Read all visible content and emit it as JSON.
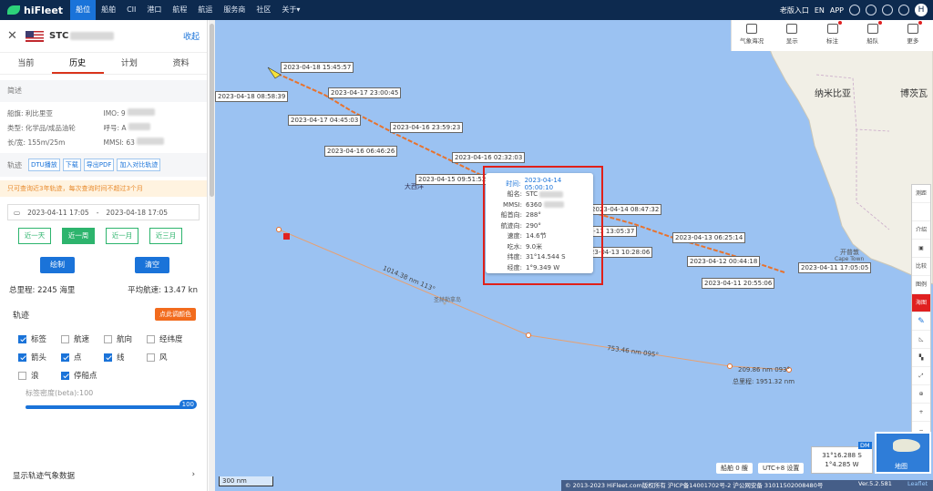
{
  "brand": {
    "name": "hiFleet"
  },
  "nav": [
    "船位",
    "船舶",
    "CII",
    "港口",
    "航程",
    "航运",
    "服务商",
    "社区",
    "关于▾"
  ],
  "topright": {
    "entry": "老版入口",
    "lang": "EN",
    "app": "APP",
    "avatar": "H"
  },
  "vessel": {
    "name_prefix": "STC",
    "collapse": "收起"
  },
  "tabs": [
    "当前",
    "历史",
    "计划",
    "资料"
  ],
  "overview": {
    "title": "简述",
    "rows": [
      [
        "船旗: 利比里亚",
        "IMO: 9"
      ],
      [
        "类型: 化学品/成品油轮",
        "呼号: A"
      ],
      [
        "长/宽: 155m/25m",
        "MMSI: 63"
      ]
    ]
  },
  "track_header": {
    "label": "轨迹",
    "buttons": [
      "DTU播放",
      "下载",
      "导出PDF",
      "加入对比轨迹"
    ]
  },
  "notice": "只可查询近3年轨迹，每次查询时间不超过3个月",
  "date_range": {
    "start": "2023-04-11 17:05",
    "sep": "-",
    "end": "2023-04-18 17:05"
  },
  "quick": [
    "近一天",
    "近一周",
    "近一月",
    "近三月"
  ],
  "actions": {
    "draw": "绘制",
    "clear": "清空"
  },
  "stats": {
    "total": "总里程: 2245 海里",
    "avg": "平均航速: 13.47 kn"
  },
  "track": {
    "title": "轨迹",
    "color_btn": "点此调颜色"
  },
  "options": [
    {
      "label": "标签",
      "checked": true
    },
    {
      "label": "航速",
      "checked": false
    },
    {
      "label": "航向",
      "checked": false
    },
    {
      "label": "经纬度",
      "checked": false
    },
    {
      "label": "箭头",
      "checked": true
    },
    {
      "label": "点",
      "checked": true
    },
    {
      "label": "线",
      "checked": true
    },
    {
      "label": "风",
      "checked": false
    },
    {
      "label": "浪",
      "checked": false
    },
    {
      "label": "停船点",
      "checked": true
    }
  ],
  "density": {
    "label": "标签密度(beta):100",
    "value": "100"
  },
  "weather_toggle": "显示轨迹气象数据",
  "map": {
    "track_labels": [
      "2023-04-18 15:45:57",
      "2023-04-18 08:58:39",
      "2023-04-17 23:00:45",
      "2023-04-17 04:45:03",
      "2023-04-16 23:59:23",
      "2023-04-16 06:46:26",
      "2023-04-16 02:32:03",
      "2023-04-15 09:51:52",
      "2023-04-14 08:47:32",
      "2023-04-13 13:05:37",
      "2023-04-13 10:28:06",
      "2023-04-13 06:25:14",
      "2023-04-12 00:44:18",
      "2023-04-11 17:05:05",
      "2023-04-11 20:55:06"
    ],
    "place_labels": {
      "namibia": "纳米比亚",
      "botswana": "博茨瓦",
      "ocean": "大西洋",
      "capetown_cn": "开普敦",
      "capetown_en": "Cape Town",
      "island": "圣赫勒拿岛"
    },
    "route_labels": {
      "seg1": "1014.38 nm 113°",
      "seg2": "753.46 nm 095°",
      "seg3": "209.86 nm 093°",
      "total": "总里程: 1951.32 nm"
    },
    "popup": {
      "rows": [
        [
          "时间:",
          "2023-04-14 05:00:10"
        ],
        [
          "船名:",
          "STC"
        ],
        [
          "MMSI:",
          "6360"
        ],
        [
          "船首向:",
          "288°"
        ],
        [
          "航迹向:",
          "290°"
        ],
        [
          "速度:",
          "14.6节"
        ],
        [
          "吃水:",
          "9.0米"
        ],
        [
          "纬度:",
          "31°14.544 S"
        ],
        [
          "经度:",
          "1°9.349 W"
        ]
      ]
    },
    "toolbar": [
      "气象海况",
      "显示",
      "标注",
      "船队",
      "更多"
    ],
    "sidetools": [
      "测距",
      "",
      "介绍",
      "",
      "比较",
      "图例",
      "海图",
      "",
      "",
      "",
      "",
      "",
      "",
      "+",
      "−"
    ],
    "scale": "300 nm",
    "ship_count": "船舶 0 艘",
    "utc": "UTC+8 设置",
    "coords": {
      "lat": "31°16.288 S",
      "lon": "1°4.285 W",
      "tag": "DM"
    },
    "minimap_label": "地图",
    "copyright": "© 2013-2023 HiFleet.com版权所有 沪ICP备14001702号-2 沪公网安备 31011502008480号",
    "version": "Ver.5.2.581",
    "leaflet": "Leaflet"
  },
  "colors": {
    "topbar": "#0d2a4f",
    "accent": "#1a73d9",
    "sea": "#9bc2f2",
    "track": "#e8722c",
    "highlight": "#e0201a"
  }
}
